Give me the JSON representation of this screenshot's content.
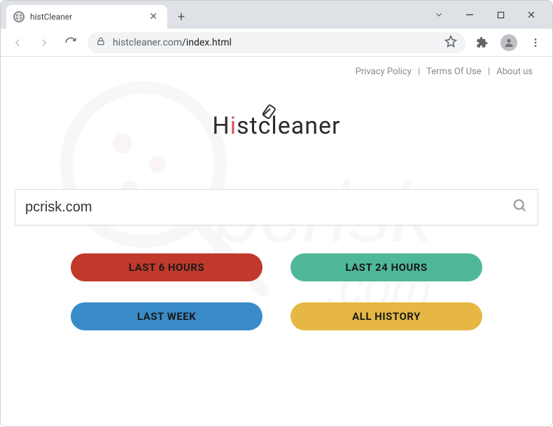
{
  "window": {
    "tab_title": "histCleaner"
  },
  "toolbar": {
    "url_secondary": "histcleaner.com",
    "url_path": "/index.html"
  },
  "page": {
    "links": {
      "privacy": "Privacy Policy",
      "terms": "Terms Of Use",
      "about": "About us"
    },
    "logo": {
      "part1": "H",
      "part2": "stcleaner"
    },
    "search": {
      "value": "pcrisk.com"
    },
    "buttons": {
      "b1": "LAST 6 HOURS",
      "b2": "LAST 24 HOURS",
      "b3": "LAST WEEK",
      "b4": "ALL HISTORY"
    }
  },
  "colors": {
    "red": "#c0392b",
    "green": "#4fb89a",
    "blue": "#3a8bc9",
    "yellow": "#e6b843"
  }
}
